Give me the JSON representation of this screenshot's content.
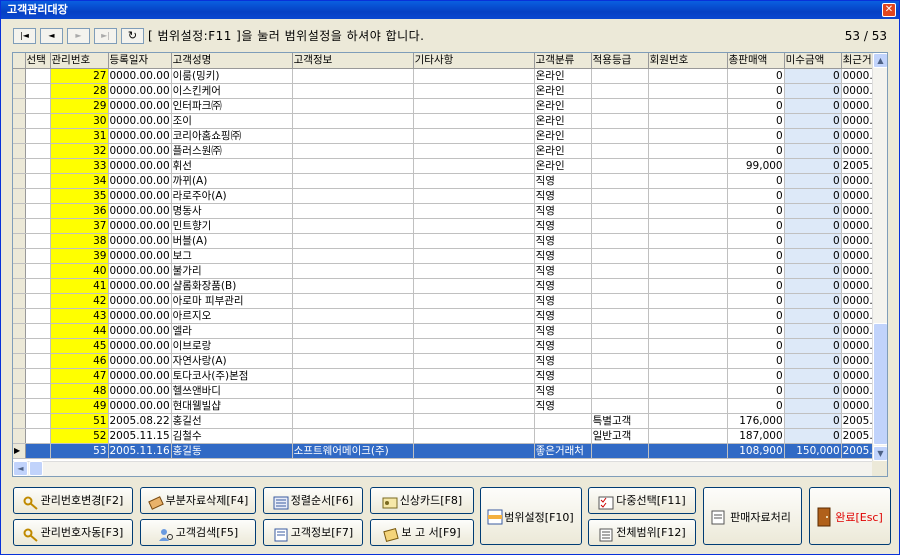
{
  "window": {
    "title": "고객관리대장",
    "close": "✕"
  },
  "nav": {
    "first": "|◄",
    "prev": "◄",
    "next": "►",
    "last": "►|",
    "refresh": "↻"
  },
  "hint": "[ 범위설정:F11 ]을 눌러 범위설정을 하셔야 합니다.",
  "counter": "53 / 53",
  "columns": [
    "선택",
    "관리번호",
    "등록일자",
    "고객성명",
    "고객정보",
    "기타사항",
    "고객분류",
    "적용등급",
    "회원번호",
    "총판매액",
    "미수금액",
    "최근거"
  ],
  "rows": [
    [
      "",
      "27",
      "0000.00.00",
      "이룸(밍키)",
      "",
      "",
      "온라인",
      "",
      "",
      "0",
      "0",
      "0000."
    ],
    [
      "",
      "28",
      "0000.00.00",
      "이스킨케어",
      "",
      "",
      "온라인",
      "",
      "",
      "0",
      "0",
      "0000."
    ],
    [
      "",
      "29",
      "0000.00.00",
      "인터파크㈜",
      "",
      "",
      "온라인",
      "",
      "",
      "0",
      "0",
      "0000."
    ],
    [
      "",
      "30",
      "0000.00.00",
      "조이",
      "",
      "",
      "온라인",
      "",
      "",
      "0",
      "0",
      "0000."
    ],
    [
      "",
      "31",
      "0000.00.00",
      "코리아홈쇼핑㈜",
      "",
      "",
      "온라인",
      "",
      "",
      "0",
      "0",
      "0000."
    ],
    [
      "",
      "32",
      "0000.00.00",
      "플러스원㈜",
      "",
      "",
      "온라인",
      "",
      "",
      "0",
      "0",
      "0000."
    ],
    [
      "",
      "33",
      "0000.00.00",
      "휘선",
      "",
      "",
      "온라인",
      "",
      "",
      "99,000",
      "0",
      "2005."
    ],
    [
      "",
      "34",
      "0000.00.00",
      "까뀌(A)",
      "",
      "",
      "직영",
      "",
      "",
      "0",
      "0",
      "0000."
    ],
    [
      "",
      "35",
      "0000.00.00",
      "라로주아(A)",
      "",
      "",
      "직영",
      "",
      "",
      "0",
      "0",
      "0000."
    ],
    [
      "",
      "36",
      "0000.00.00",
      "명동사",
      "",
      "",
      "직영",
      "",
      "",
      "0",
      "0",
      "0000."
    ],
    [
      "",
      "37",
      "0000.00.00",
      "민트향기",
      "",
      "",
      "직영",
      "",
      "",
      "0",
      "0",
      "0000."
    ],
    [
      "",
      "38",
      "0000.00.00",
      "버블(A)",
      "",
      "",
      "직영",
      "",
      "",
      "0",
      "0",
      "0000."
    ],
    [
      "",
      "39",
      "0000.00.00",
      "보그",
      "",
      "",
      "직영",
      "",
      "",
      "0",
      "0",
      "0000."
    ],
    [
      "",
      "40",
      "0000.00.00",
      "불가리",
      "",
      "",
      "직영",
      "",
      "",
      "0",
      "0",
      "0000."
    ],
    [
      "",
      "41",
      "0000.00.00",
      "샬롬화장품(B)",
      "",
      "",
      "직영",
      "",
      "",
      "0",
      "0",
      "0000."
    ],
    [
      "",
      "42",
      "0000.00.00",
      "아로마 피부관리",
      "",
      "",
      "직영",
      "",
      "",
      "0",
      "0",
      "0000."
    ],
    [
      "",
      "43",
      "0000.00.00",
      "아르지오",
      "",
      "",
      "직영",
      "",
      "",
      "0",
      "0",
      "0000."
    ],
    [
      "",
      "44",
      "0000.00.00",
      "엘라",
      "",
      "",
      "직영",
      "",
      "",
      "0",
      "0",
      "0000."
    ],
    [
      "",
      "45",
      "0000.00.00",
      "이브로랑",
      "",
      "",
      "직영",
      "",
      "",
      "0",
      "0",
      "0000."
    ],
    [
      "",
      "46",
      "0000.00.00",
      "자연사랑(A)",
      "",
      "",
      "직영",
      "",
      "",
      "0",
      "0",
      "0000."
    ],
    [
      "",
      "47",
      "0000.00.00",
      "토다코사(주)본점",
      "",
      "",
      "직영",
      "",
      "",
      "0",
      "0",
      "0000."
    ],
    [
      "",
      "48",
      "0000.00.00",
      "헬쓰앤바디",
      "",
      "",
      "직영",
      "",
      "",
      "0",
      "0",
      "0000."
    ],
    [
      "",
      "49",
      "0000.00.00",
      "현대웰빌샵",
      "",
      "",
      "직영",
      "",
      "",
      "0",
      "0",
      "0000."
    ],
    [
      "",
      "51",
      "2005.08.22",
      "홍길선",
      "",
      "",
      "",
      "특별고객",
      "",
      "176,000",
      "0",
      "2005."
    ],
    [
      "",
      "52",
      "2005.11.15",
      "김철수",
      "",
      "",
      "",
      "일반고객",
      "",
      "187,000",
      "0",
      "2005."
    ],
    [
      "",
      "53",
      "2005.11.16",
      "홍길동",
      "소프트웨어메이크(주)",
      "",
      "좋은거래처",
      "",
      "",
      "108,900",
      "150,000",
      "2005."
    ]
  ],
  "selected_index": 25,
  "buttons": {
    "b1": "관리번호변경[F2]",
    "b2": "부분자료삭제[F4]",
    "b3": "정렬순서[F6]",
    "b4": "신상카드[F8]",
    "b5": "관리번호자동[F3]",
    "b6": "고객검색[F5]",
    "b7": "고객정보[F7]",
    "b8": "보 고 서[F9]",
    "b9": "범위설정[F10]",
    "b10": "다중선택[F11]",
    "b11": "전체범위[F12]",
    "b12": "판매자료처리",
    "b13": "완료[Esc]"
  },
  "colors": {
    "accent": "#316ac5",
    "highlight_yellow": "#ffff00",
    "light_blue": "#dde9f8",
    "title_blue": "#0a5fe0"
  }
}
